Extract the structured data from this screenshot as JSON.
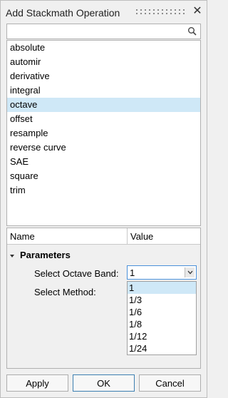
{
  "window": {
    "title": "Add Stackmath Operation"
  },
  "search": {
    "value": "",
    "placeholder": ""
  },
  "operations": [
    {
      "label": "absolute",
      "selected": false
    },
    {
      "label": "automir",
      "selected": false
    },
    {
      "label": "derivative",
      "selected": false
    },
    {
      "label": "integral",
      "selected": false
    },
    {
      "label": "octave",
      "selected": true
    },
    {
      "label": "offset",
      "selected": false
    },
    {
      "label": "resample",
      "selected": false
    },
    {
      "label": "reverse curve",
      "selected": false
    },
    {
      "label": "SAE",
      "selected": false
    },
    {
      "label": "square",
      "selected": false
    },
    {
      "label": "trim",
      "selected": false
    }
  ],
  "properties": {
    "col_name": "Name",
    "col_value": "Value",
    "group": "Parameters",
    "octave_band_label": "Select Octave Band:",
    "octave_band_value": "1",
    "method_label": "Select Method:",
    "dropdown_options": [
      "1",
      "1/3",
      "1/6",
      "1/8",
      "1/12",
      "1/24"
    ]
  },
  "buttons": {
    "apply": "Apply",
    "ok": "OK",
    "cancel": "Cancel"
  },
  "colors": {
    "selection": "#cfe8f7",
    "focus_border": "#4a90d9"
  }
}
